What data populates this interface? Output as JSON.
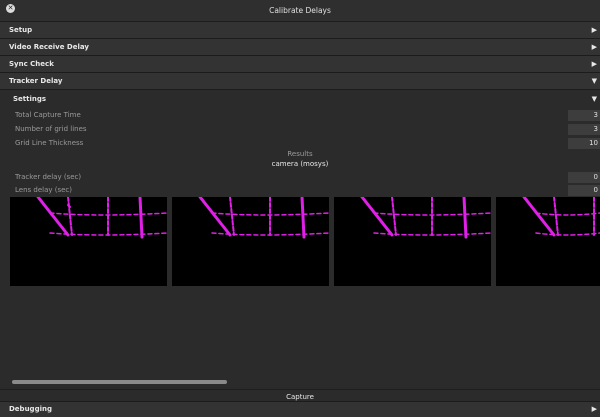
{
  "window": {
    "title": "Calibrate Delays",
    "close_icon": "close-icon"
  },
  "sections": {
    "setup": "Setup",
    "video_receive_delay": "Video Receive Delay",
    "sync_check": "Sync Check",
    "tracker_delay": "Tracker Delay",
    "debugging": "Debugging"
  },
  "settings": {
    "label": "Settings",
    "total_capture_time": {
      "label": "Total Capture Time",
      "value": "3"
    },
    "number_of_grid_lines": {
      "label": "Number of grid lines",
      "value": "3"
    },
    "grid_line_thickness": {
      "label": "Grid Line Thickness",
      "value": "10"
    }
  },
  "results": {
    "title": "Results",
    "camera": "camera (mosys)",
    "tracker_delay": {
      "label": "Tracker delay (sec)",
      "value": "0"
    },
    "lens_delay": {
      "label": "Lens delay (sec)",
      "value": "0"
    }
  },
  "capture_label": "Capture",
  "colors": {
    "grid_line": "#e020e8",
    "background": "#2b2b2b"
  },
  "icons": {
    "expand": "triangle-right-icon",
    "collapse": "triangle-down-icon"
  }
}
